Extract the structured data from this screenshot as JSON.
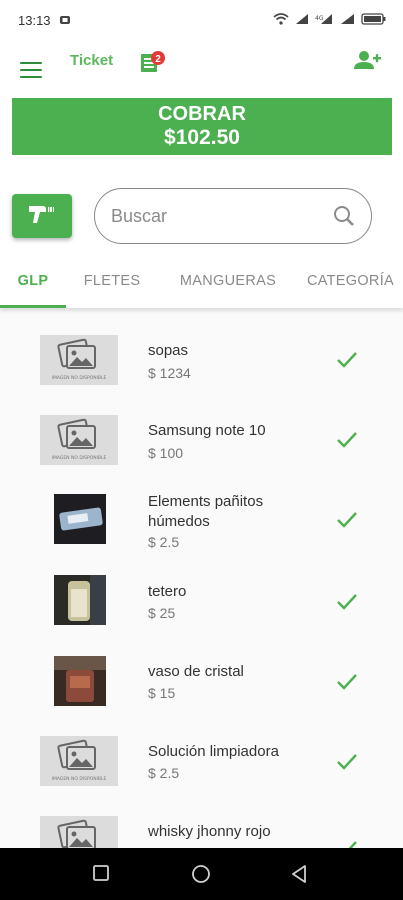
{
  "status_bar": {
    "time": "13:13"
  },
  "app_bar": {
    "ticket_label": "Ticket",
    "ticket_badge": "2"
  },
  "cobrar": {
    "label": "COBRAR",
    "amount": "$102.50"
  },
  "search": {
    "placeholder": "Buscar"
  },
  "tabs": [
    {
      "label": "GLP",
      "active": true
    },
    {
      "label": "FLETES",
      "active": false
    },
    {
      "label": "MANGUERAS",
      "active": false
    },
    {
      "label": "CATEGORÍA",
      "active": false
    }
  ],
  "products": [
    {
      "name": "sopas",
      "price": "$ 1234",
      "image": "placeholder",
      "selected": true
    },
    {
      "name": "Samsung note 10",
      "price": "$ 100",
      "image": "placeholder",
      "selected": true
    },
    {
      "name": "Elements pañitos húmedos",
      "price": "$ 2.5",
      "image": "photo",
      "selected": true
    },
    {
      "name": "tetero",
      "price": "$ 25",
      "image": "photo",
      "selected": true
    },
    {
      "name": "vaso de cristal",
      "price": "$ 15",
      "image": "photo",
      "selected": true
    },
    {
      "name": "Solución limpiadora",
      "price": "$ 2.5",
      "image": "placeholder",
      "selected": true
    },
    {
      "name": "whisky jhonny rojo",
      "price": "",
      "image": "placeholder",
      "selected": true
    }
  ],
  "placeholder_image_text": "IMAGEN NO DISPONIBLE",
  "colors": {
    "accent": "#4caf50",
    "accent_dark": "#2d8b3c",
    "badge": "#e53935"
  },
  "icons": [
    "menu-icon",
    "ticket-list-icon",
    "add-person-icon",
    "barcode-scanner-icon",
    "search-icon",
    "checkmark-icon",
    "image-placeholder-icon",
    "square-nav-icon",
    "circle-nav-icon",
    "triangle-back-icon"
  ]
}
